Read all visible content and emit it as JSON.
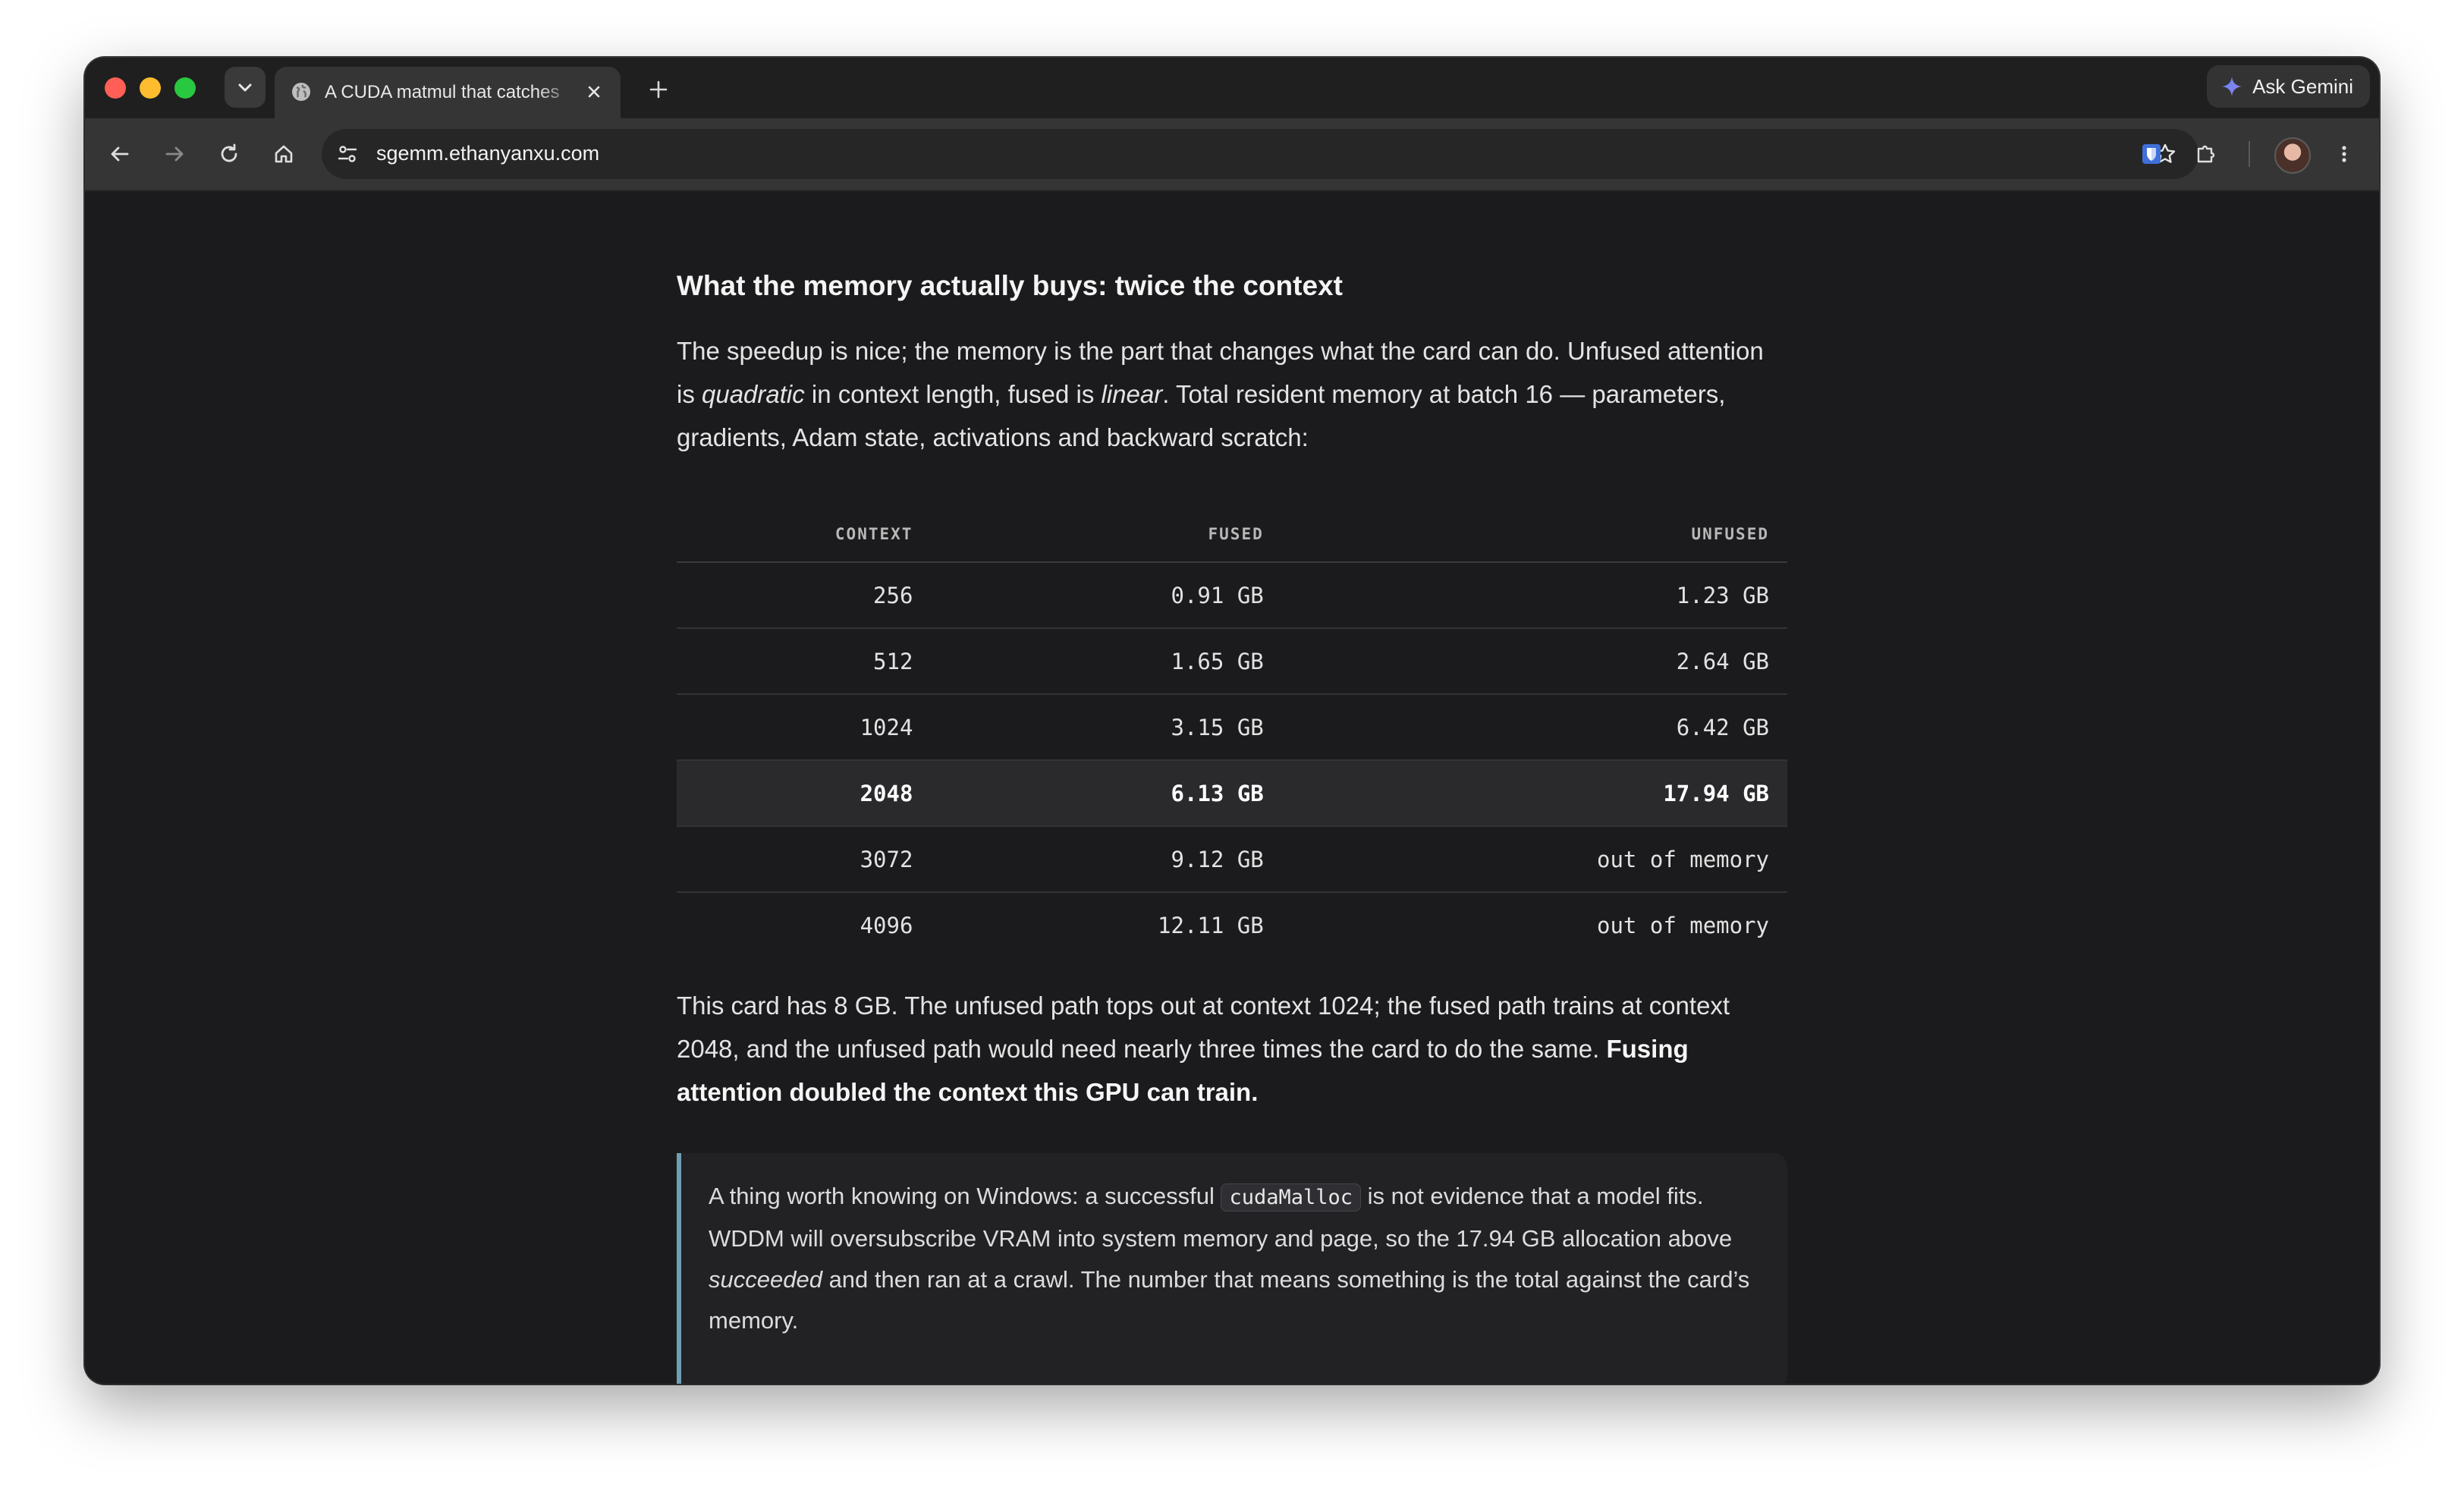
{
  "browser": {
    "tab": {
      "title": "A CUDA matmul that catches"
    },
    "ask_gemini_label": "Ask Gemini",
    "url": "sgemm.ethanyanxu.com",
    "colors": {
      "close": "#ff5f57",
      "minimize": "#febc2e",
      "maximize": "#28c840"
    }
  },
  "article": {
    "section_title": "What the memory actually buys: twice the context",
    "intro": {
      "part1": "The speedup is nice; the memory is the part that changes what the card can do. Unfused attention is ",
      "em1": "quadratic",
      "part2": " in context length, fused is ",
      "em2": "linear",
      "part3": ". Total resident memory at batch 16 — parameters, gradients, Adam state, activations and backward scratch:"
    },
    "table": {
      "headers": [
        "CONTEXT",
        "FUSED",
        "UNFUSED"
      ],
      "rows": [
        [
          "256",
          "0.91 GB",
          "1.23 GB"
        ],
        [
          "512",
          "1.65 GB",
          "2.64 GB"
        ],
        [
          "1024",
          "3.15 GB",
          "6.42 GB"
        ],
        [
          "2048",
          "6.13 GB",
          "17.94 GB"
        ],
        [
          "3072",
          "9.12 GB",
          "out of memory"
        ],
        [
          "4096",
          "12.11 GB",
          "out of memory"
        ]
      ],
      "highlighted_row_context": "2048"
    },
    "after": {
      "text": "This card has 8 GB. The unfused path tops out at context 1024; the fused path trains at context 2048, and the unfused path would need nearly three times the card to do the same. ",
      "strong": "Fusing attention doubled the context this GPU can train."
    },
    "callout": {
      "part1": "A thing worth knowing on Windows: a successful ",
      "code": "cudaMalloc",
      "part2": " is not evidence that a model fits. WDDM will oversubscribe VRAM into system memory and page, so the 17.94 GB allocation above ",
      "em": "succeeded",
      "part3": " and then ran at a crawl. The number that means something is the total against the card’s memory.",
      "accent_color": "#6e9fb3"
    }
  }
}
